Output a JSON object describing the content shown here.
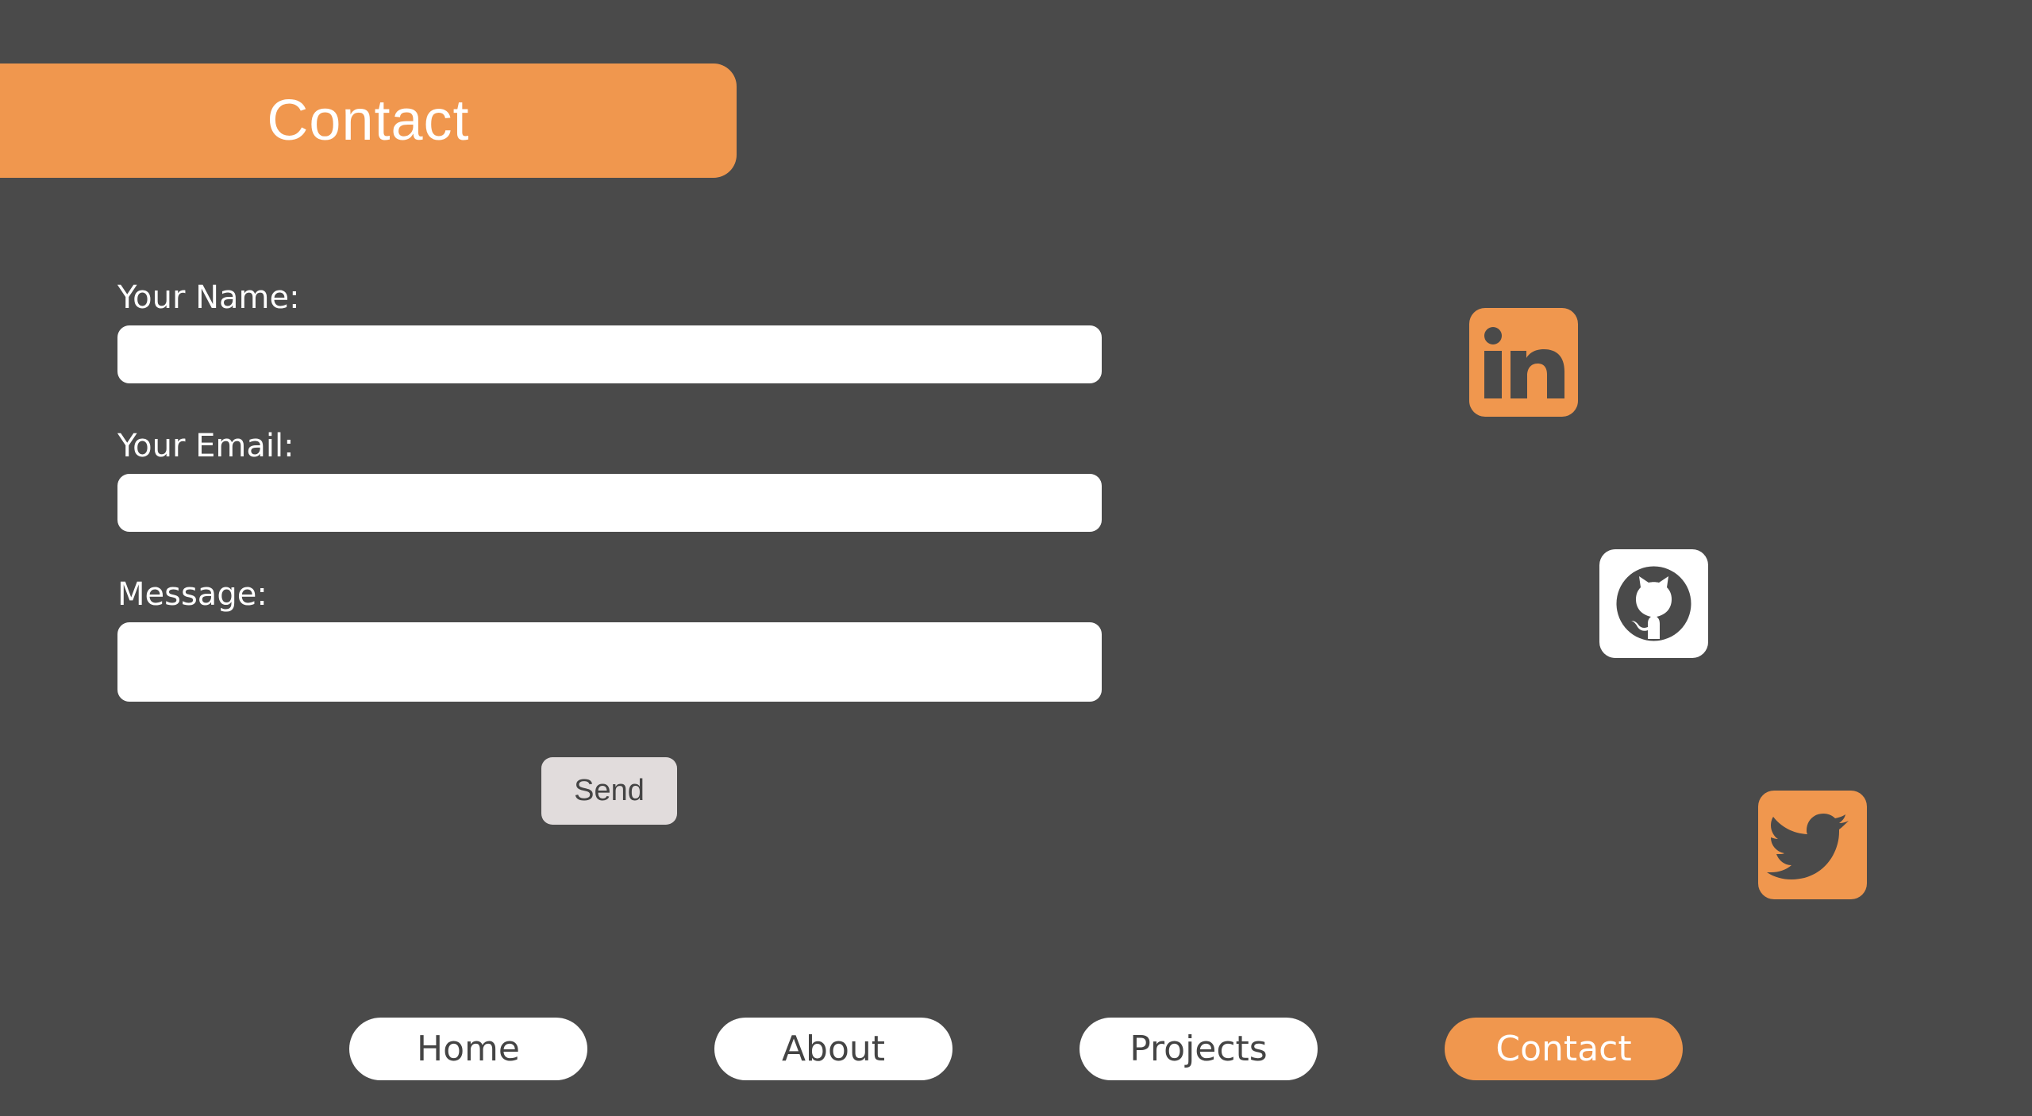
{
  "page": {
    "title": "Contact"
  },
  "form": {
    "name_label": "Your Name:",
    "name_value": "",
    "email_label": "Your Email:",
    "email_value": "",
    "message_label": "Message:",
    "message_value": "",
    "send_label": "Send"
  },
  "social": [
    {
      "name": "linkedin-icon",
      "color": "#f0974e"
    },
    {
      "name": "github-icon",
      "color": "#ffffff"
    },
    {
      "name": "twitter-icon",
      "color": "#f0974e"
    }
  ],
  "nav": {
    "items": [
      {
        "label": "Home",
        "active": false
      },
      {
        "label": "About",
        "active": false
      },
      {
        "label": "Projects",
        "active": false
      },
      {
        "label": "Contact",
        "active": true
      }
    ]
  },
  "colors": {
    "background": "#4a4a4a",
    "accent": "#f0974e",
    "button": "#e1dcdc",
    "text_dark": "#444444",
    "text_light": "#ffffff"
  }
}
